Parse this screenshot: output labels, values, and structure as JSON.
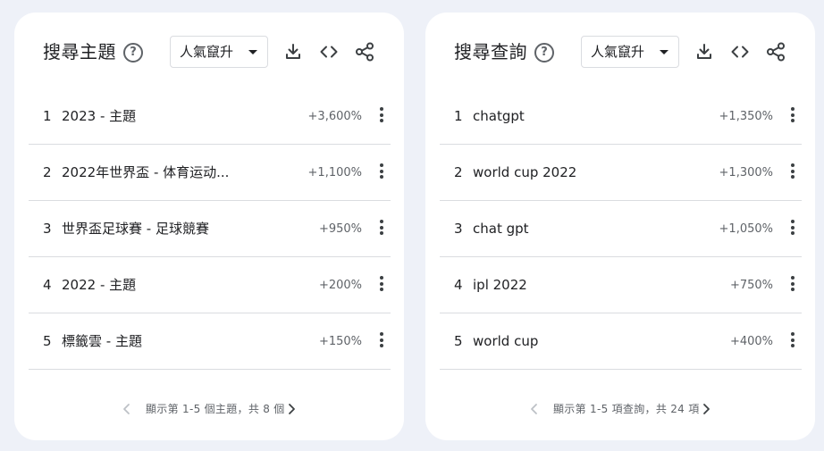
{
  "panels": [
    {
      "title": "搜尋主題",
      "dropdown": "人氣竄升",
      "rows": [
        {
          "index": "1",
          "label": "2023 - 主題",
          "value": "+3,600%"
        },
        {
          "index": "2",
          "label": "2022年世界盃 - 体育运动...",
          "value": "+1,100%"
        },
        {
          "index": "3",
          "label": "世界盃足球賽 - 足球競賽",
          "value": "+950%"
        },
        {
          "index": "4",
          "label": "2022 - 主題",
          "value": "+200%"
        },
        {
          "index": "5",
          "label": "標籤雲 - 主題",
          "value": "+150%"
        }
      ],
      "pager": "顯示第 1-5 個主題，共 8 個"
    },
    {
      "title": "搜尋查詢",
      "dropdown": "人氣竄升",
      "rows": [
        {
          "index": "1",
          "label": "chatgpt",
          "value": "+1,350%"
        },
        {
          "index": "2",
          "label": "world cup 2022",
          "value": "+1,300%"
        },
        {
          "index": "3",
          "label": "chat gpt",
          "value": "+1,050%"
        },
        {
          "index": "4",
          "label": "ipl 2022",
          "value": "+750%"
        },
        {
          "index": "5",
          "label": "world cup",
          "value": "+400%"
        }
      ],
      "pager": "顯示第 1-5 項查詢，共 24 項"
    }
  ],
  "icons": {
    "help": "help-circle-icon",
    "download": "download-icon",
    "embed": "code-icon",
    "share": "share-icon",
    "more": "more-vert-icon",
    "prev": "chevron-left-icon",
    "next": "chevron-right-icon"
  },
  "colors": {
    "background": "#eef1f8",
    "card": "#ffffff",
    "text": "#202124",
    "secondary": "#5f6368",
    "divider": "#dadce0",
    "disabled": "#bdc1c6"
  }
}
